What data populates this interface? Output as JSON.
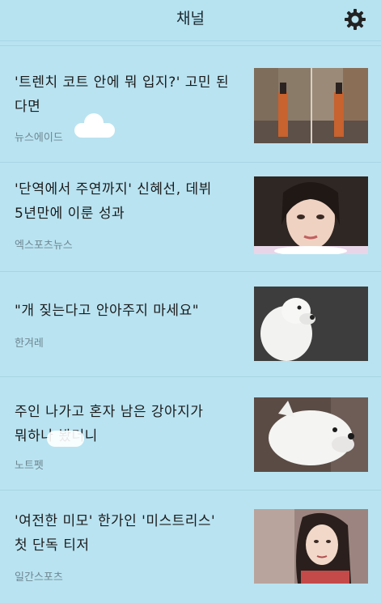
{
  "header": {
    "title": "채널",
    "settings_icon": "gear-icon"
  },
  "items": [
    {
      "headline": "'트렌치 코트 안에 뭐 입지?' 고민 된다면",
      "source": "뉴스에이드"
    },
    {
      "headline": "'단역에서 주연까지' 신혜선, 데뷔 5년만에 이룬 성과",
      "source": "엑스포츠뉴스"
    },
    {
      "headline": "\"개 짖는다고 안아주지 마세요\"",
      "source": "한겨레"
    },
    {
      "headline": "주인 나가고 혼자 남은 강아지가 뭐하나 봤더니",
      "source": "노트펫"
    },
    {
      "headline": "'여전한 미모' 한가인 '미스트리스' 첫 단독 티저",
      "source": "일간스포츠"
    }
  ]
}
